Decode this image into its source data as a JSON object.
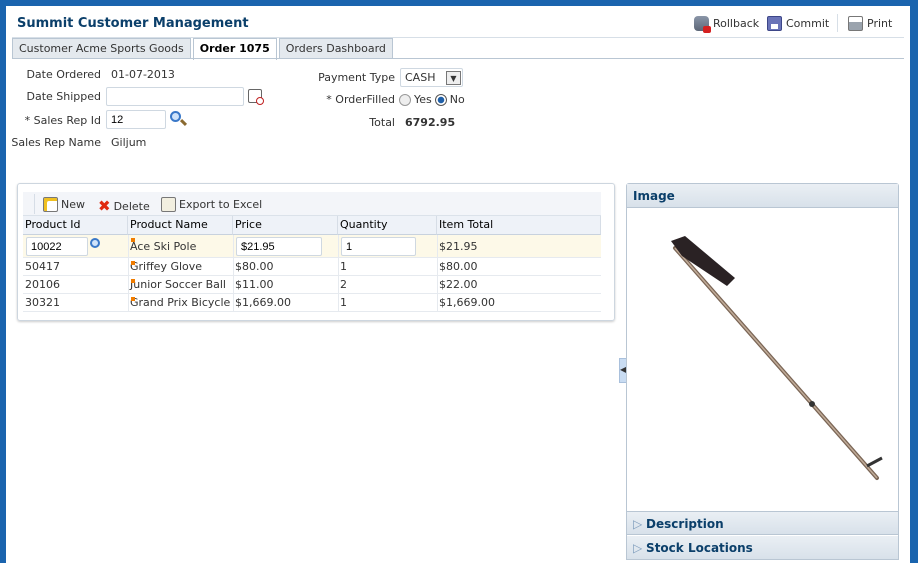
{
  "app": {
    "title": "Summit Customer Management"
  },
  "toolbar": {
    "rollback": "Rollback",
    "commit": "Commit",
    "print": "Print"
  },
  "tabs": [
    {
      "label": "Customer Acme Sports Goods"
    },
    {
      "label": "Order 1075"
    },
    {
      "label": "Orders Dashboard"
    }
  ],
  "form": {
    "date_ordered_label": "Date Ordered",
    "date_ordered": "01-07-2013",
    "date_shipped_label": "Date Shipped",
    "date_shipped": "",
    "sales_rep_id_label": "* Sales Rep Id",
    "sales_rep_id": "12",
    "sales_rep_name_label": "Sales Rep Name",
    "sales_rep_name": "Giljum",
    "payment_type_label": "Payment Type",
    "payment_type": "CASH",
    "order_filled_label": "* OrderFilled",
    "yes": "Yes",
    "no": "No",
    "order_filled_selected": "No",
    "total_label": "Total",
    "total": "6792.95"
  },
  "table": {
    "actions": {
      "new": "New",
      "delete": "Delete",
      "export": "Export to Excel"
    },
    "columns": [
      "Product Id",
      "Product Name",
      "Price",
      "Quantity",
      "Item Total"
    ],
    "rows": [
      [
        "10022",
        "Ace Ski Pole",
        "$21.95",
        "1",
        "$21.95"
      ],
      [
        "50417",
        "Griffey Glove",
        "$80.00",
        "1",
        "$80.00"
      ],
      [
        "20106",
        "Junior Soccer Ball",
        "$11.00",
        "2",
        "$22.00"
      ],
      [
        "30321",
        "Grand Prix Bicycle",
        "$1,669.00",
        "1",
        "$1,669.00"
      ]
    ]
  },
  "side": {
    "image": "Image",
    "description": "Description",
    "stock": "Stock Locations"
  }
}
